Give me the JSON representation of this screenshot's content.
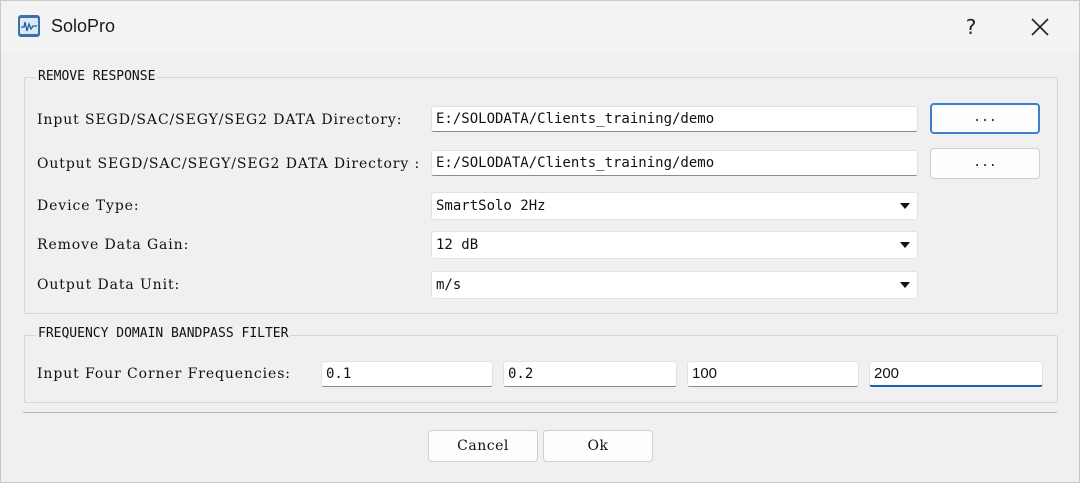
{
  "window": {
    "title": "SoloPro",
    "help_glyph": "?",
    "icons": {
      "app": "waveform-app-icon",
      "help": "question-mark-icon",
      "close": "close-x-icon"
    }
  },
  "remove_response": {
    "title": "REMOVE RESPONSE",
    "input_dir": {
      "label": "Input SEGD/SAC/SEGY/SEG2 DATA Directory:",
      "value": "E:/SOLODATA/Clients_training/demo",
      "browse_label": "..."
    },
    "output_dir": {
      "label": "Output SEGD/SAC/SEGY/SEG2 DATA Directory :",
      "value": "E:/SOLODATA/Clients_training/demo",
      "browse_label": "..."
    },
    "device_type": {
      "label": "Device Type:",
      "selected": "SmartSolo 2Hz"
    },
    "remove_gain": {
      "label": "Remove Data Gain:",
      "selected": "12 dB"
    },
    "output_unit": {
      "label": "Output Data Unit:",
      "selected": "m/s"
    }
  },
  "bandpass": {
    "title": "FREQUENCY DOMAIN BANDPASS FILTER",
    "corners_label": "Input Four Corner Frequencies:",
    "corners": [
      "0.1",
      "0.2",
      "100",
      "200"
    ]
  },
  "buttons": {
    "cancel": "Cancel",
    "ok": "Ok"
  },
  "colors": {
    "focus_accent": "#1f5fb0",
    "default_button_border": "#3d7fd0",
    "app_icon_bg": "#3d6fae"
  }
}
